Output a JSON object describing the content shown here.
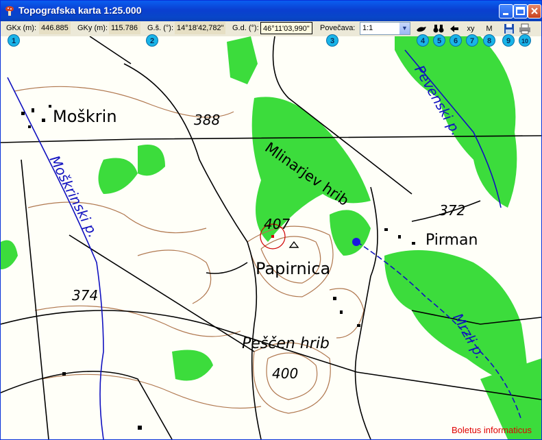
{
  "window": {
    "title": "Topografska karta 1:25.000"
  },
  "toolbar": {
    "gkx_label": "GKx (m):",
    "gkx_value": "446.885",
    "gky_label": "GKy (m):",
    "gky_value": "115.786",
    "gs_label": "G.š. (°):",
    "gs_value": "14°18'42,782\"",
    "gd_label": "G.d. (°):",
    "gd_value": "46°11'03,990\"",
    "zoom_label": "Povečava:",
    "zoom_value": "1:1",
    "xy_label": "xy",
    "m_label": "M"
  },
  "badges": [
    "1",
    "2",
    "3",
    "4",
    "5",
    "6",
    "7",
    "8",
    "9",
    "10"
  ],
  "map": {
    "labels": {
      "moskrin": "Moškrin",
      "h388": "388",
      "mlinarjev": "Mlinarjev hrib",
      "h407": "407",
      "papirnica": "Papirnica",
      "h372": "372",
      "pirman": "Pirman",
      "h374": "374",
      "pescen": "Peščen hrib",
      "h400": "400"
    },
    "rivers": {
      "moskrinski": "Moškrinski p.",
      "pevenski": "Pevenski p.",
      "mrzli": "Mrzli p."
    },
    "brand": "Boletus informaticus"
  },
  "colors": {
    "forest": "#3cdc3c",
    "contour": "#b07850",
    "water": "#1010c0",
    "road": "#000000"
  }
}
